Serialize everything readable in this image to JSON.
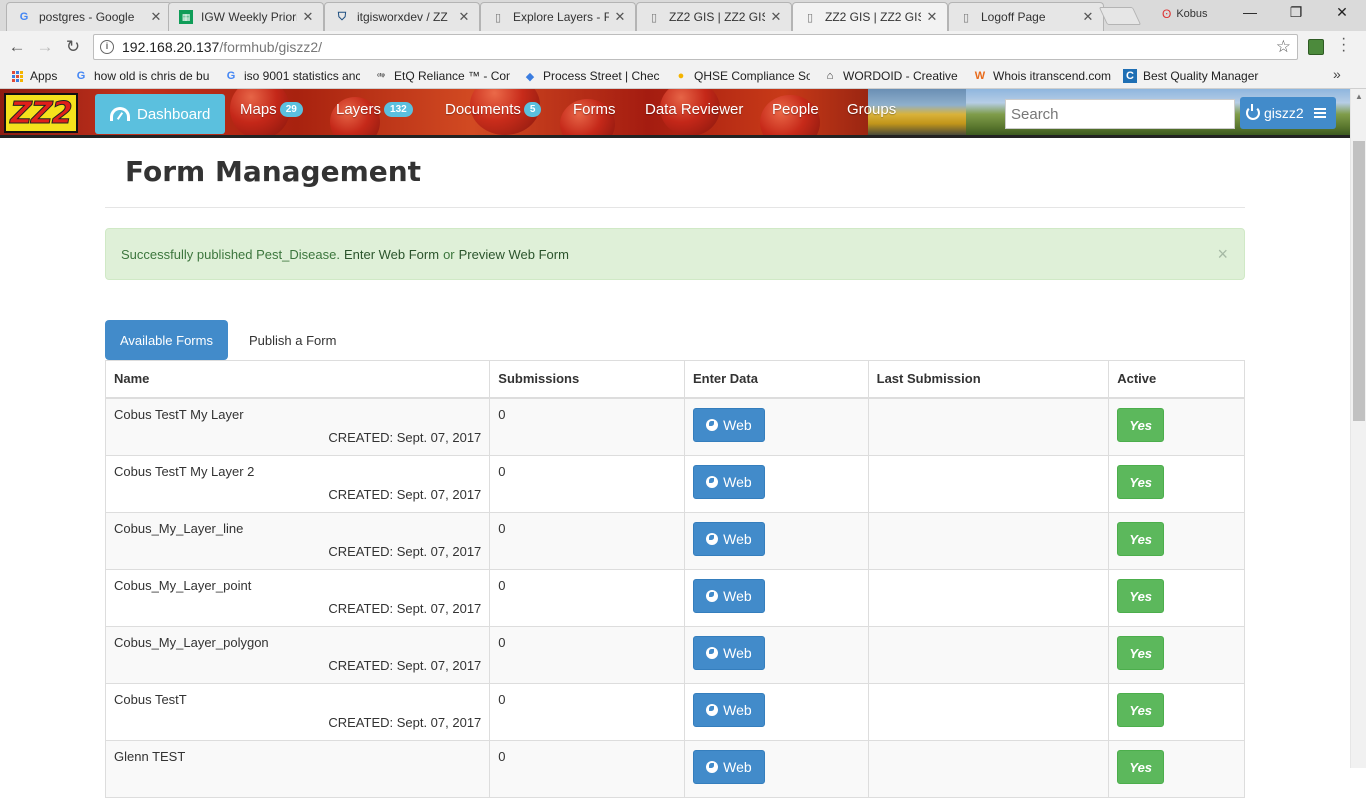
{
  "browser": {
    "tabs": [
      {
        "title": "postgres - Google",
        "icon": "google-icon"
      },
      {
        "title": "IGW Weekly Priori",
        "icon": "sheets-icon"
      },
      {
        "title": "itgisworxdev / ZZ",
        "icon": "bitbucket-icon"
      },
      {
        "title": "Explore Layers - F",
        "icon": "page-icon"
      },
      {
        "title": "ZZ2 GIS | ZZ2 GIS",
        "icon": "page-icon"
      },
      {
        "title": "ZZ2 GIS | ZZ2 GIS",
        "icon": "page-icon"
      },
      {
        "title": "Logoff Page",
        "icon": "page-icon"
      }
    ],
    "active_tab": 5,
    "profile_name": "Kobus",
    "url_host": "192.168.20.137",
    "url_path": "/formhub/giszz2/",
    "bookmarks": [
      {
        "label": "Apps"
      },
      {
        "label": "how old is chris de bu"
      },
      {
        "label": "iso 9001 statistics anc"
      },
      {
        "label": "EtQ Reliance ™ - Com"
      },
      {
        "label": "Process Street | Check"
      },
      {
        "label": "QHSE Compliance So"
      },
      {
        "label": "WORDOID - Creative"
      },
      {
        "label": "Whois itranscend.com"
      },
      {
        "label": "Best Quality Manager"
      }
    ]
  },
  "nav": {
    "logo": "ZZ2",
    "dashboard": "Dashboard",
    "maps": "Maps",
    "maps_count": "29",
    "layers": "Layers",
    "layers_count": "132",
    "documents": "Documents",
    "documents_count": "5",
    "forms": "Forms",
    "data_reviewer": "Data Reviewer",
    "people": "People",
    "groups": "Groups",
    "search_placeholder": "Search",
    "username": "giszz2"
  },
  "page": {
    "title": "Form Management",
    "alert_prefix": "Successfully published Pest_Disease.",
    "alert_link1": "Enter Web Form",
    "alert_or": "or",
    "alert_link2": "Preview Web Form",
    "alert_close": "×",
    "tab_available": "Available Forms",
    "tab_publish": "Publish a Form"
  },
  "table": {
    "headers": [
      "Name",
      "Submissions",
      "Enter Data",
      "Last Submission",
      "Active"
    ],
    "web_label": "Web",
    "rows": [
      {
        "name": "Cobus TestT My Layer",
        "created": "CREATED: Sept. 07, 2017",
        "submissions": "0",
        "last": "",
        "active": "Yes"
      },
      {
        "name": "Cobus TestT My Layer 2",
        "created": "CREATED: Sept. 07, 2017",
        "submissions": "0",
        "last": "",
        "active": "Yes"
      },
      {
        "name": "Cobus_My_Layer_line",
        "created": "CREATED: Sept. 07, 2017",
        "submissions": "0",
        "last": "",
        "active": "Yes"
      },
      {
        "name": "Cobus_My_Layer_point",
        "created": "CREATED: Sept. 07, 2017",
        "submissions": "0",
        "last": "",
        "active": "Yes"
      },
      {
        "name": "Cobus_My_Layer_polygon",
        "created": "CREATED: Sept. 07, 2017",
        "submissions": "0",
        "last": "",
        "active": "Yes"
      },
      {
        "name": "Cobus TestT",
        "created": "CREATED: Sept. 07, 2017",
        "submissions": "0",
        "last": "",
        "active": "Yes"
      },
      {
        "name": "Glenn TEST",
        "created": "",
        "submissions": "0",
        "last": "",
        "active": "Yes"
      }
    ]
  },
  "colors": {
    "primary": "#428bca",
    "info": "#5bc0de",
    "success": "#5cb85c",
    "alert_bg": "#dff0d8"
  }
}
